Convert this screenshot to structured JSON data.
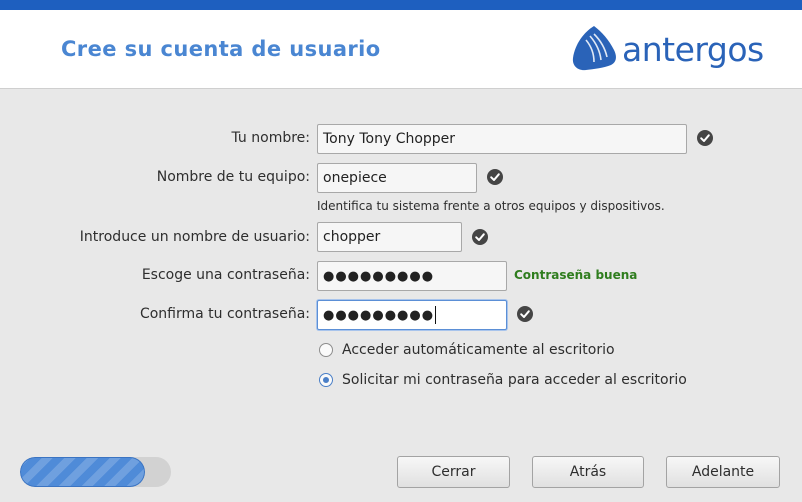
{
  "header": {
    "title": "Cree su cuenta de usuario",
    "logo_text": "antergos"
  },
  "form": {
    "name": {
      "label": "Tu nombre:",
      "value": "Tony Tony Chopper",
      "valid": true
    },
    "hostname": {
      "label": "Nombre de tu equipo:",
      "value": "onepiece",
      "valid": true,
      "hint": "Identifica tu sistema frente a otros equipos y dispositivos."
    },
    "username": {
      "label": "Introduce un nombre de usuario:",
      "value": "chopper",
      "valid": true
    },
    "password": {
      "label": "Escoge una contraseña:",
      "masked_value": "●●●●●●●●●",
      "strength": "Contraseña buena"
    },
    "confirm": {
      "label": "Confirma tu contraseña:",
      "masked_value": "●●●●●●●●●",
      "valid": true
    }
  },
  "login_options": [
    {
      "label": "Acceder automáticamente al escritorio",
      "selected": false
    },
    {
      "label": "Solicitar mi contraseña para acceder al escritorio",
      "selected": true
    }
  ],
  "progress": {
    "fraction": 0.83
  },
  "buttons": {
    "close": "Cerrar",
    "back": "Atrás",
    "next": "Adelante"
  },
  "colors": {
    "accent": "#1e5fbf",
    "title": "#4a86d2",
    "strength_good": "#2f7d1e"
  }
}
